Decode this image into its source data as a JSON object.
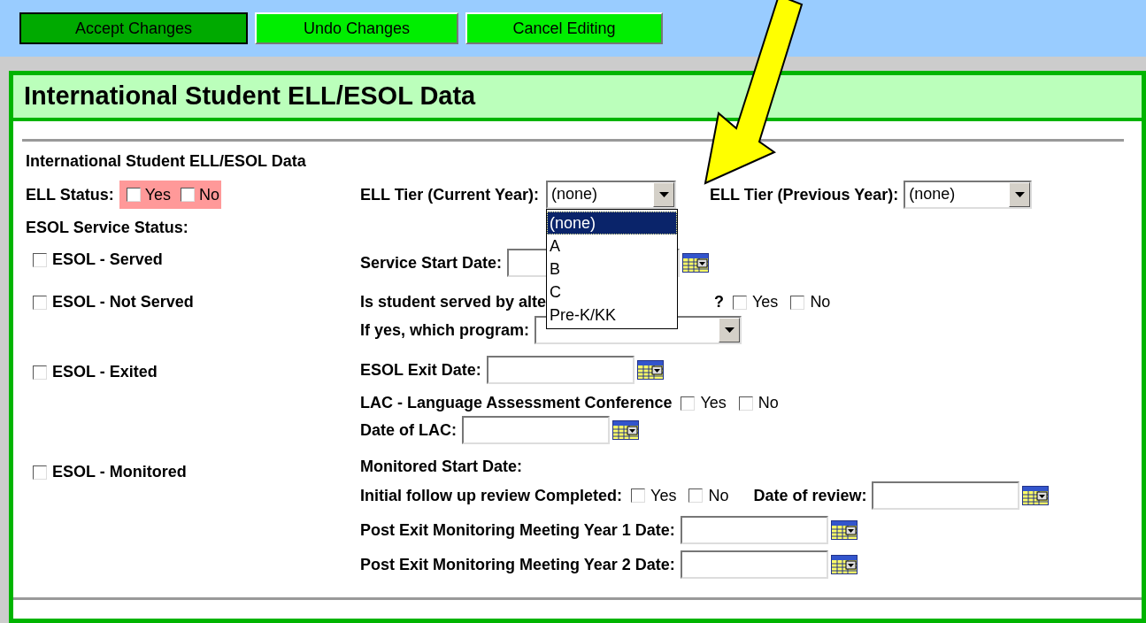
{
  "toolbar": {
    "buttons": [
      {
        "label": "Accept Changes",
        "selected": true
      },
      {
        "label": "Undo Changes",
        "selected": false
      },
      {
        "label": "Cancel Editing",
        "selected": false
      }
    ]
  },
  "panel_title": "International Student ELL/ESOL Data",
  "section_title": "International Student ELL/ESOL Data",
  "ell_status": {
    "label": "ELL Status:",
    "options": [
      {
        "label": "Yes",
        "checked": false
      },
      {
        "label": "No",
        "checked": false
      }
    ]
  },
  "ell_tier_current": {
    "label": "ELL Tier (Current Year):",
    "value": "(none)",
    "expanded": true,
    "options": [
      {
        "label": "(none)",
        "selected": true
      },
      {
        "label": "A",
        "selected": false
      },
      {
        "label": "B",
        "selected": false
      },
      {
        "label": "C",
        "selected": false
      },
      {
        "label": "Pre-K/KK",
        "selected": false
      }
    ]
  },
  "ell_tier_previous": {
    "label": "ELL Tier (Previous Year):",
    "value": "(none)"
  },
  "service_status_label": "ESOL Service Status:",
  "rows": [
    {
      "status": {
        "label": "ESOL - Served",
        "checked": false
      },
      "items": [
        {
          "kind": "label",
          "text": "Service Start Date:"
        },
        {
          "kind": "date"
        }
      ]
    },
    {
      "status": {
        "label": "ESOL - Not Served",
        "checked": false
      },
      "items": [
        {
          "kind": "cut_label",
          "text": "Is student served by alte"
        },
        {
          "kind": "label",
          "text": "?"
        },
        {
          "kind": "yesno",
          "options": [
            {
              "label": "Yes",
              "checked": false
            },
            {
              "label": "No",
              "checked": false
            }
          ]
        }
      ]
    },
    {
      "items": [
        {
          "kind": "label",
          "text": "If yes, which program:"
        },
        {
          "kind": "select"
        }
      ]
    },
    {
      "status": {
        "label": "ESOL - Exited",
        "checked": false
      },
      "items": [
        {
          "kind": "label",
          "text": "ESOL Exit Date:"
        },
        {
          "kind": "date"
        }
      ]
    },
    {
      "items": [
        {
          "kind": "label",
          "text": "LAC - Language Assessment Conference"
        },
        {
          "kind": "yesno",
          "options": [
            {
              "label": "Yes",
              "checked": false
            },
            {
              "label": "No",
              "checked": false
            }
          ]
        }
      ]
    },
    {
      "items": [
        {
          "kind": "label",
          "text": "Date of LAC:"
        },
        {
          "kind": "date"
        }
      ]
    },
    {
      "status": {
        "label": "ESOL - Monitored",
        "checked": false
      },
      "items": [
        {
          "kind": "label",
          "text": "Monitored Start Date:"
        }
      ]
    },
    {
      "items": [
        {
          "kind": "label",
          "text": "Initial follow up review Completed:"
        },
        {
          "kind": "yesno",
          "options": [
            {
              "label": "Yes",
              "checked": false
            },
            {
              "label": "No",
              "checked": false
            }
          ]
        },
        {
          "kind": "label",
          "text": "Date of review:"
        },
        {
          "kind": "date"
        }
      ]
    },
    {
      "items": [
        {
          "kind": "label",
          "text": "Post Exit Monitoring Meeting Year 1 Date:"
        },
        {
          "kind": "date"
        }
      ]
    },
    {
      "items": [
        {
          "kind": "label",
          "text": "Post Exit Monitoring Meeting Year 2 Date:"
        },
        {
          "kind": "date"
        }
      ]
    }
  ]
}
